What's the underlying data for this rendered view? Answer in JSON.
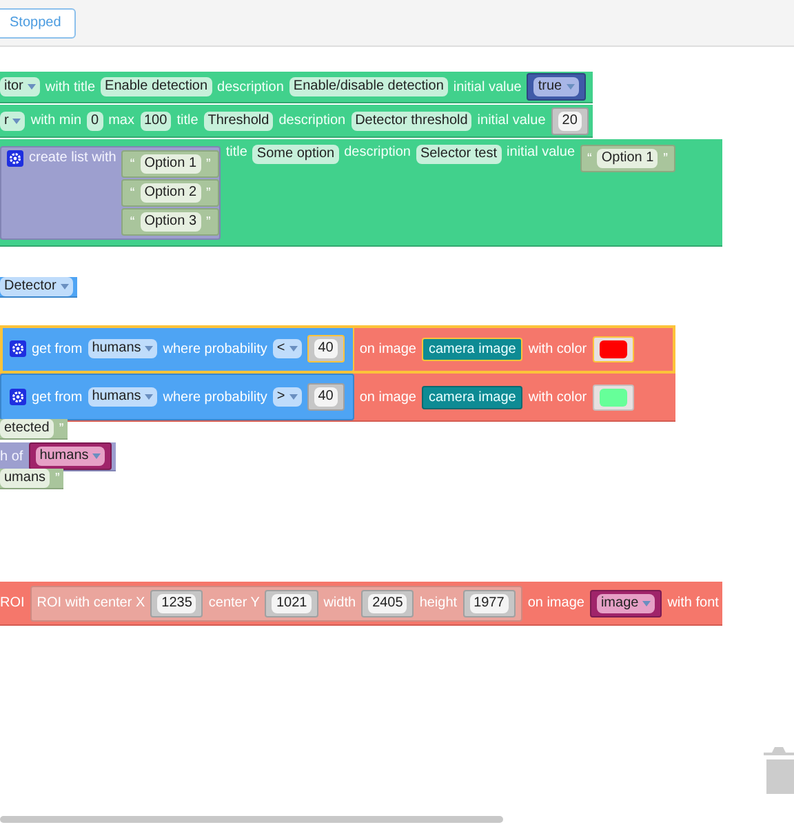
{
  "toolbar": {
    "status_button": "Stopped"
  },
  "blocks": [
    {
      "kind": "param",
      "selected": false,
      "parts": [
        {
          "kind": "dropdown",
          "text": "itor"
        },
        {
          "kind": "label",
          "text": "with title"
        },
        {
          "kind": "field",
          "text": "Enable detection"
        },
        {
          "kind": "label",
          "text": "description"
        },
        {
          "kind": "field",
          "text": "Enable/disable detection"
        },
        {
          "kind": "label",
          "text": "initial value"
        },
        {
          "kind": "logic",
          "parts": [
            {
              "kind": "dropdown",
              "text": "true"
            }
          ]
        }
      ]
    },
    {
      "kind": "param",
      "selected": false,
      "parts": [
        {
          "kind": "dropdown",
          "text": "r"
        },
        {
          "kind": "label",
          "text": "with min"
        },
        {
          "kind": "field",
          "text": "0"
        },
        {
          "kind": "label",
          "text": "max"
        },
        {
          "kind": "field",
          "text": "100"
        },
        {
          "kind": "label",
          "text": "title"
        },
        {
          "kind": "field",
          "text": "Threshold"
        },
        {
          "kind": "label",
          "text": "description"
        },
        {
          "kind": "field",
          "text": "Detector threshold"
        },
        {
          "kind": "label",
          "text": "initial value"
        },
        {
          "kind": "number",
          "parts": [
            {
              "kind": "field",
              "text": "20"
            }
          ]
        }
      ]
    },
    {
      "kind": "param",
      "selected": false,
      "parts": [
        {
          "kind": "list",
          "parts": [
            {
              "kind": "gear"
            },
            {
              "kind": "label",
              "text": "create list with"
            },
            {
              "kind": "stack",
              "blocks": [
                {
                  "kind": "text",
                  "parts": [
                    {
                      "kind": "label",
                      "text": "“"
                    },
                    {
                      "kind": "field",
                      "text": "Option 1"
                    },
                    {
                      "kind": "label",
                      "text": "”"
                    }
                  ]
                },
                {
                  "kind": "text",
                  "parts": [
                    {
                      "kind": "label",
                      "text": "“"
                    },
                    {
                      "kind": "field",
                      "text": "Option 2"
                    },
                    {
                      "kind": "label",
                      "text": "”"
                    }
                  ]
                },
                {
                  "kind": "text",
                  "parts": [
                    {
                      "kind": "label",
                      "text": "“"
                    },
                    {
                      "kind": "field",
                      "text": "Option 3"
                    },
                    {
                      "kind": "label",
                      "text": "”"
                    }
                  ]
                }
              ]
            }
          ]
        },
        {
          "kind": "label",
          "text": "title"
        },
        {
          "kind": "field",
          "text": "Some option"
        },
        {
          "kind": "label",
          "text": "description"
        },
        {
          "kind": "field",
          "text": "Selector test"
        },
        {
          "kind": "label",
          "text": "initial value"
        },
        {
          "kind": "text",
          "parts": [
            {
              "kind": "label",
              "text": "“"
            },
            {
              "kind": "field",
              "text": "Option 1"
            },
            {
              "kind": "label",
              "text": "”"
            }
          ]
        }
      ]
    },
    {
      "kind": "variable",
      "selected": false,
      "parts": [
        {
          "kind": "dropdown",
          "text": "Detector"
        }
      ]
    },
    {
      "kind": "draw",
      "selected": true,
      "parts": [
        {
          "kind": "filter",
          "parts": [
            {
              "kind": "gear"
            },
            {
              "kind": "label",
              "text": "get from"
            },
            {
              "kind": "dropdown",
              "text": "humans"
            },
            {
              "kind": "label",
              "text": "where probability"
            },
            {
              "kind": "dropdown",
              "text": "<"
            },
            {
              "kind": "number",
              "parts": [
                {
                  "kind": "field",
                  "text": "40"
                }
              ]
            }
          ]
        },
        {
          "kind": "label",
          "text": "on image"
        },
        {
          "kind": "image",
          "parts": [
            {
              "kind": "label",
              "text": "camera image"
            }
          ]
        },
        {
          "kind": "label",
          "text": "with color"
        },
        {
          "kind": "colour",
          "parts": [
            {
              "kind": "swatch",
              "color": "#ff0000"
            }
          ]
        }
      ]
    },
    {
      "kind": "draw",
      "selected": false,
      "parts": [
        {
          "kind": "filter",
          "parts": [
            {
              "kind": "gear"
            },
            {
              "kind": "label",
              "text": "get from"
            },
            {
              "kind": "dropdown",
              "text": "humans"
            },
            {
              "kind": "label",
              "text": "where probability"
            },
            {
              "kind": "dropdown",
              "text": ">"
            },
            {
              "kind": "number",
              "parts": [
                {
                  "kind": "field",
                  "text": "40"
                }
              ]
            }
          ]
        },
        {
          "kind": "label",
          "text": "on image"
        },
        {
          "kind": "image",
          "parts": [
            {
              "kind": "label",
              "text": "camera image"
            }
          ]
        },
        {
          "kind": "label",
          "text": "with color"
        },
        {
          "kind": "colour",
          "parts": [
            {
              "kind": "swatch",
              "color": "#66ff99"
            }
          ]
        }
      ]
    },
    {
      "kind": "text",
      "selected": false,
      "parts": [
        {
          "kind": "field",
          "text": "etected"
        },
        {
          "kind": "label",
          "text": "”"
        }
      ]
    },
    {
      "kind": "list",
      "selected": false,
      "parts": [
        {
          "kind": "label",
          "text": "h of"
        },
        {
          "kind": "variable_list",
          "parts": [
            {
              "kind": "dropdown",
              "text": "humans"
            }
          ]
        }
      ]
    },
    {
      "kind": "text",
      "selected": false,
      "parts": [
        {
          "kind": "field",
          "text": "umans"
        },
        {
          "kind": "label",
          "text": "”"
        }
      ]
    },
    {
      "kind": "draw",
      "selected": false,
      "parts": [
        {
          "kind": "label",
          "text": "ROI"
        },
        {
          "kind": "roi",
          "parts": [
            {
              "kind": "label",
              "text": "ROI with center X"
            },
            {
              "kind": "number",
              "parts": [
                {
                  "kind": "field",
                  "text": "1235"
                }
              ]
            },
            {
              "kind": "label",
              "text": "center Y"
            },
            {
              "kind": "number",
              "parts": [
                {
                  "kind": "field",
                  "text": "1021"
                }
              ]
            },
            {
              "kind": "label",
              "text": "width"
            },
            {
              "kind": "number",
              "parts": [
                {
                  "kind": "field",
                  "text": "2405"
                }
              ]
            },
            {
              "kind": "label",
              "text": "height"
            },
            {
              "kind": "number",
              "parts": [
                {
                  "kind": "field",
                  "text": "1977"
                }
              ]
            }
          ]
        },
        {
          "kind": "label",
          "text": "on image"
        },
        {
          "kind": "variable_list",
          "parts": [
            {
              "kind": "dropdown",
              "text": "image"
            }
          ]
        },
        {
          "kind": "label",
          "text": "with font"
        }
      ]
    }
  ]
}
